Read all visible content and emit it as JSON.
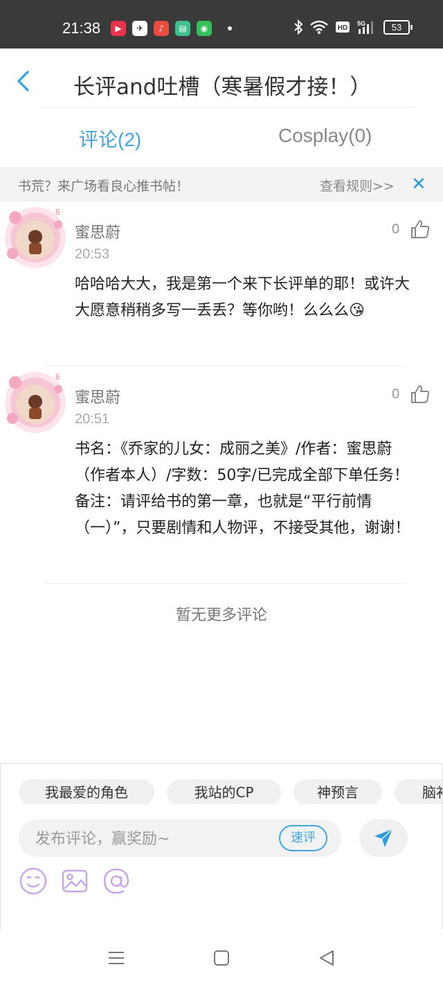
{
  "status_bar": {
    "time": "21:38",
    "battery": "53",
    "app_icons": [
      "video-app-icon",
      "messenger-app-icon",
      "music-app-icon",
      "notes-app-icon",
      "wechat-app-icon"
    ],
    "system_icons": [
      "bluetooth-icon",
      "wifi-icon",
      "hd-icon",
      "signal-5g-icon",
      "battery-icon"
    ]
  },
  "header": {
    "title": "长评and吐槽（寒暑假才接！）"
  },
  "tabs": [
    {
      "label": "评论(2)",
      "active": true
    },
    {
      "label": "Cosplay(0)",
      "active": false
    }
  ],
  "notice": {
    "text": "书荒？来广场看良心推书帖！",
    "link": "查看规则>>",
    "close": "✕"
  },
  "comments": [
    {
      "username": "蜜思蔚",
      "time": "20:53",
      "likes": "0",
      "text": "哈哈哈大大，我是第一个来下长评单的耶！或许大大愿意稍稍多写一丢丢？等你哟！么么么😘"
    },
    {
      "username": "蜜思蔚",
      "time": "20:51",
      "likes": "0",
      "text": "书名：《乔家的儿女：成丽之美》/作者：蜜思蔚（作者本人）/字数：50字/已完成全部下单任务！备注：请评给书的第一章，也就是“平行前情（一）”，只要剧情和人物评，不接受其他，谢谢！"
    }
  ],
  "no_more": "暂无更多评论",
  "composer": {
    "chips": [
      "我最爱的角色",
      "我站的CP",
      "神预言",
      "脑补"
    ],
    "placeholder": "发布评论，赢奖励~",
    "quick_label": "速评",
    "tools": [
      "emoji-icon",
      "image-icon",
      "mention-icon"
    ]
  },
  "colors": {
    "accent": "#3fa6df",
    "status_bar": "#3a3a3a",
    "notice_bg": "#f3f3f3",
    "tool_icon": "#c9a7e6"
  }
}
